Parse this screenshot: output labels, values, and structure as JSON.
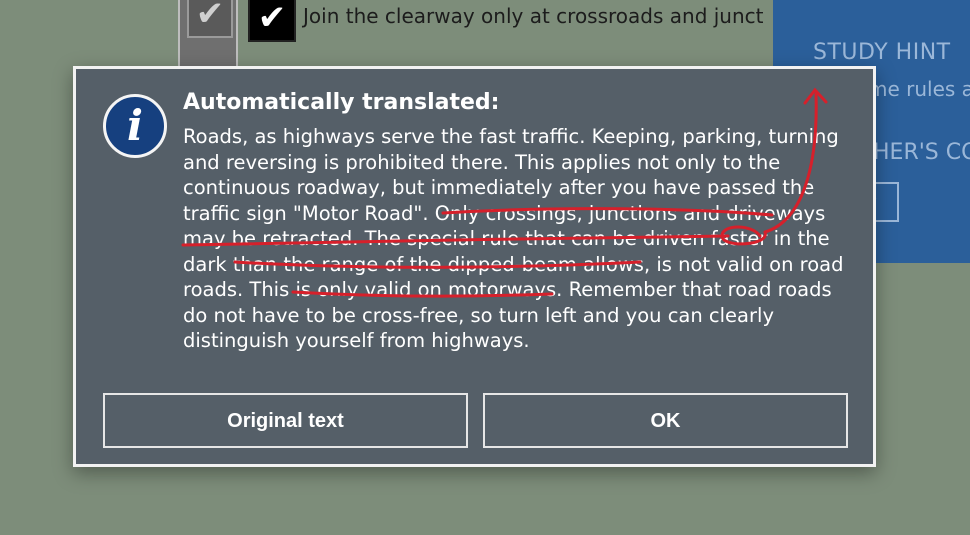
{
  "background": {
    "answer_text": "Join the clearway only at crossroads and junct",
    "gray_checkbox_icon": "check-icon",
    "black_checkbox_icon": "check-icon",
    "colors": {
      "page": "#7d8d7a",
      "panel": "#2b5f9a"
    }
  },
  "hint_panel": {
    "title": "STUDY HINT",
    "line1": "me rules a",
    "line2": "HER'S CO",
    "button_fragment": "y"
  },
  "dialog": {
    "icon": "info-icon",
    "icon_glyph": "i",
    "title": "Automatically translated:",
    "body": "Roads, as highways serve the fast traffic. Keeping, parking, turning and reversing is prohibited there. This applies not only to the continuous roadway, but immediately after you have passed the traffic sign \"Motor Road\". Only crossings, junctions and driveways may be retracted. The special rule that can be driven faster in the dark than the range of the dipped-beam allows, is not valid on road roads. This is only valid on motorways. Remember that road roads do not have to be cross-free, so turn left and you can clearly distinguish yourself from highways.",
    "original_text_button": "Original text",
    "ok_button": "OK",
    "colors": {
      "background": "#555f68",
      "border": "#f2f2f2",
      "icon": "#16407f"
    }
  },
  "annotations": {
    "color": "#d6202b"
  }
}
